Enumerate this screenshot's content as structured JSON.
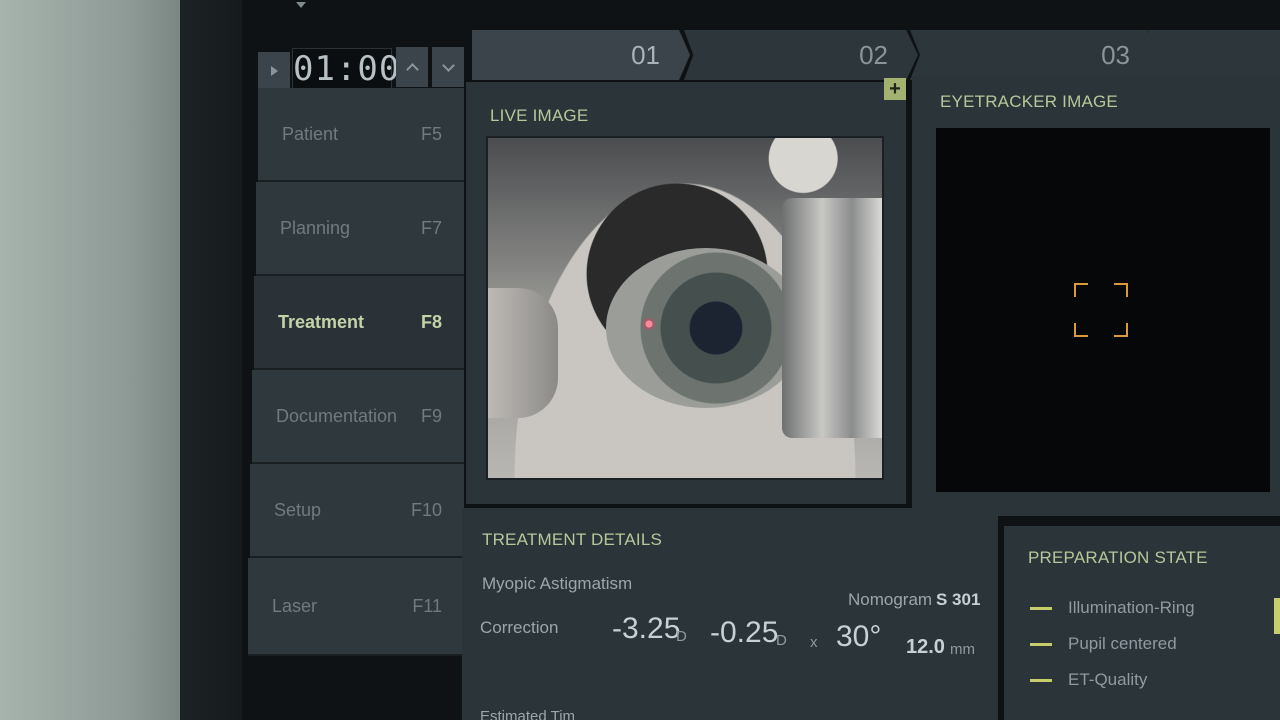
{
  "timer": {
    "value": "01:00"
  },
  "nav": [
    {
      "label": "Patient",
      "key": "F5"
    },
    {
      "label": "Planning",
      "key": "F7"
    },
    {
      "label": "Treatment",
      "key": "F8",
      "active": true
    },
    {
      "label": "Documentation",
      "key": "F9"
    },
    {
      "label": "Setup",
      "key": "F10"
    },
    {
      "label": "Laser",
      "key": "F11"
    }
  ],
  "steps": [
    "01",
    "02",
    "03"
  ],
  "live": {
    "title": "LIVE IMAGE",
    "add_label": "+"
  },
  "eyetracker": {
    "title": "EYETRACKER IMAGE"
  },
  "details": {
    "title": "TREATMENT DETAILS",
    "procedure": "Myopic Astigmatism",
    "nomogram_label": "Nomogram",
    "nomogram_value": "S 301",
    "correction_label": "Correction",
    "sphere": "-3.25",
    "sphere_unit": "D",
    "cylinder": "-0.25",
    "cylinder_unit": "D",
    "times": "x",
    "axis": "30°",
    "zone": "12.0",
    "zone_unit": "mm",
    "estimated_label": "Estimated Tim"
  },
  "preparation": {
    "title": "PREPARATION STATE",
    "items": [
      "Illumination-Ring",
      "Pupil centered",
      "ET-Quality"
    ]
  },
  "colors": {
    "accent": "#b8c79b",
    "status_ok": "#c6cd6a",
    "tracker": "#d99a3c"
  }
}
